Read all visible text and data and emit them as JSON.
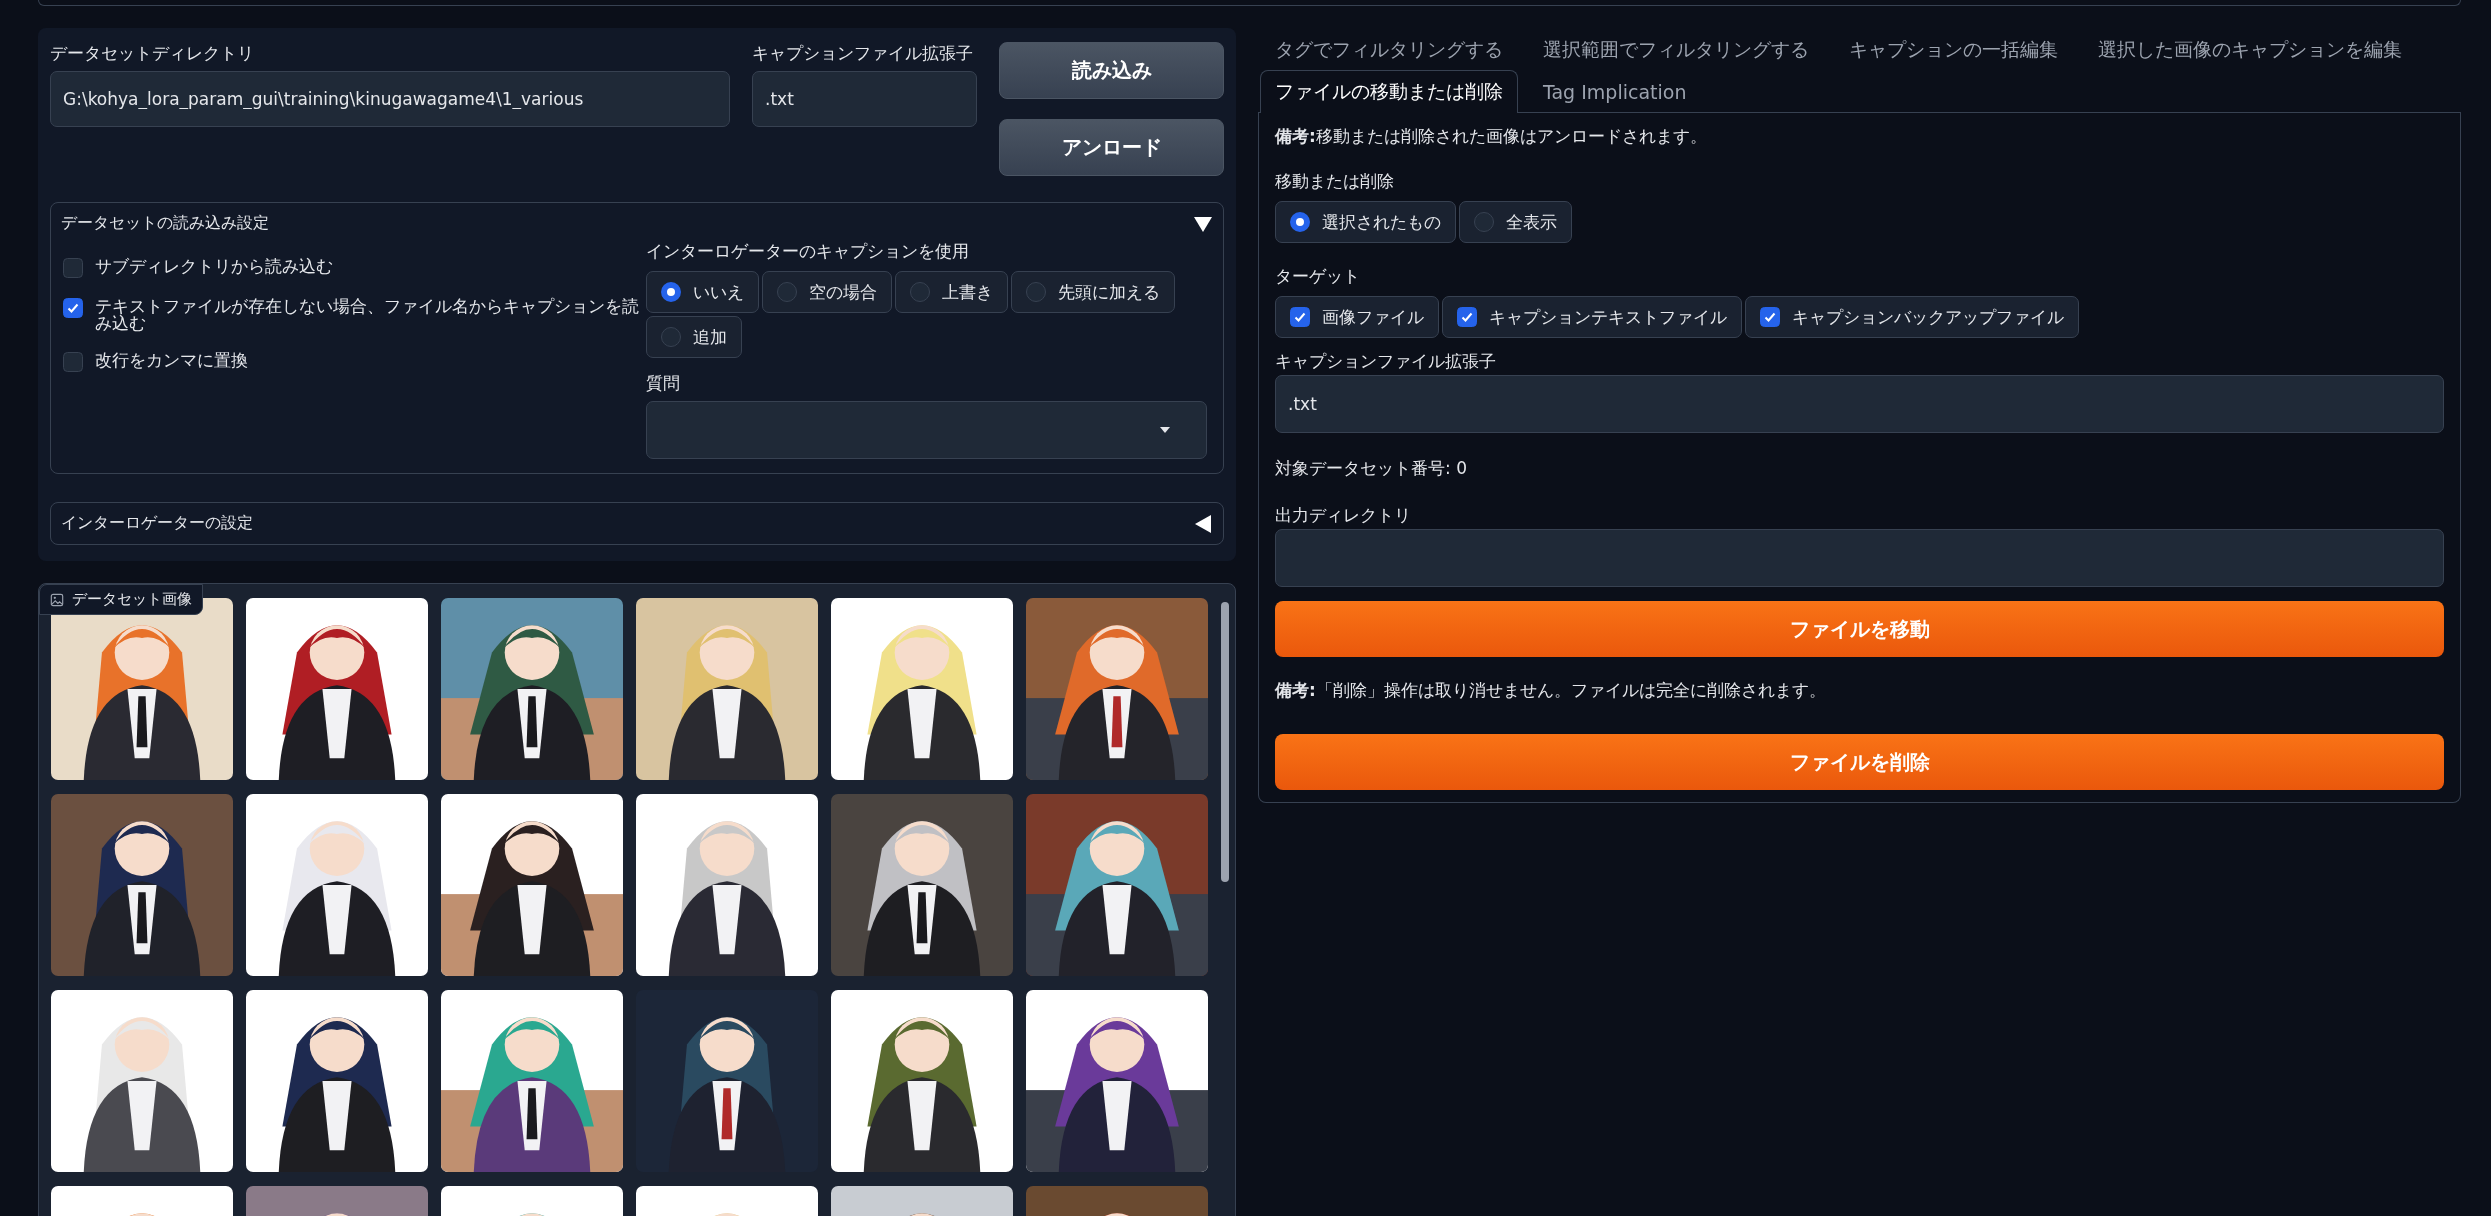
{
  "left_panel": {
    "dataset_directory": {
      "label": "データセットディレクトリ",
      "value": "G:\\kohya_lora_param_gui\\training\\kinugawagame4\\1_various"
    },
    "caption_extension": {
      "label": "キャプションファイル拡張子",
      "value": ".txt"
    },
    "buttons": [
      "読み込み",
      "アンロード"
    ],
    "load_settings": {
      "title": "データセットの読み込み設定",
      "expanded": true,
      "checkboxes": [
        {
          "label": "サブディレクトリから読み込む",
          "checked": false
        },
        {
          "label": "テキストファイルが存在しない場合、ファイル名からキャプションを読み込む",
          "checked": true
        },
        {
          "label": "改行をカンマに置換",
          "checked": false
        }
      ],
      "interrogator_caption": {
        "label": "インターロゲーターのキャプションを使用",
        "options": [
          {
            "label": "いいえ",
            "selected": true
          },
          {
            "label": "空の場合",
            "selected": false
          },
          {
            "label": "上書き",
            "selected": false
          },
          {
            "label": "先頭に加える",
            "selected": false
          },
          {
            "label": "追加",
            "selected": false
          }
        ]
      },
      "question": {
        "label": "質問"
      }
    },
    "interrogator_settings": {
      "title": "インターロゲーターの設定",
      "expanded": false
    }
  },
  "gallery": {
    "label": "データセット画像"
  },
  "right_panel": {
    "tab_rows": [
      [
        {
          "label": "タグでフィルタリングする",
          "selected": false
        },
        {
          "label": "選択範囲でフィルタリングする",
          "selected": false
        },
        {
          "label": "キャプションの一括編集",
          "selected": false
        },
        {
          "label": "選択した画像のキャプションを編集",
          "selected": false
        }
      ],
      [
        {
          "label": "ファイルの移動または削除",
          "selected": true
        },
        {
          "label": "Tag Implication",
          "selected": false
        }
      ]
    ],
    "note_unload": "**備考:**移動または削除された画像はアンロードされます。",
    "move_or_delete": {
      "label": "移動または削除",
      "options": [
        {
          "label": "選択されたもの",
          "selected": true
        },
        {
          "label": "全表示",
          "selected": false
        }
      ]
    },
    "target": {
      "label": "ターゲット",
      "checkboxes": [
        {
          "label": "画像ファイル",
          "checked": true
        },
        {
          "label": "キャプションテキストファイル",
          "checked": true
        },
        {
          "label": "キャプションバックアップファイル",
          "checked": true
        }
      ]
    },
    "caption_extension": {
      "label": "キャプションファイル拡張子",
      "value": ".txt"
    },
    "target_dataset_number": "対象データセット番号: 0",
    "output_directory": {
      "label": "出力ディレクトリ"
    },
    "move_button": "ファイルを移動",
    "note_delete": "**備考:**「削除」操作は取り消せません。ファイルは完全に削除されます。",
    "delete_button": "ファイルを削除"
  }
}
